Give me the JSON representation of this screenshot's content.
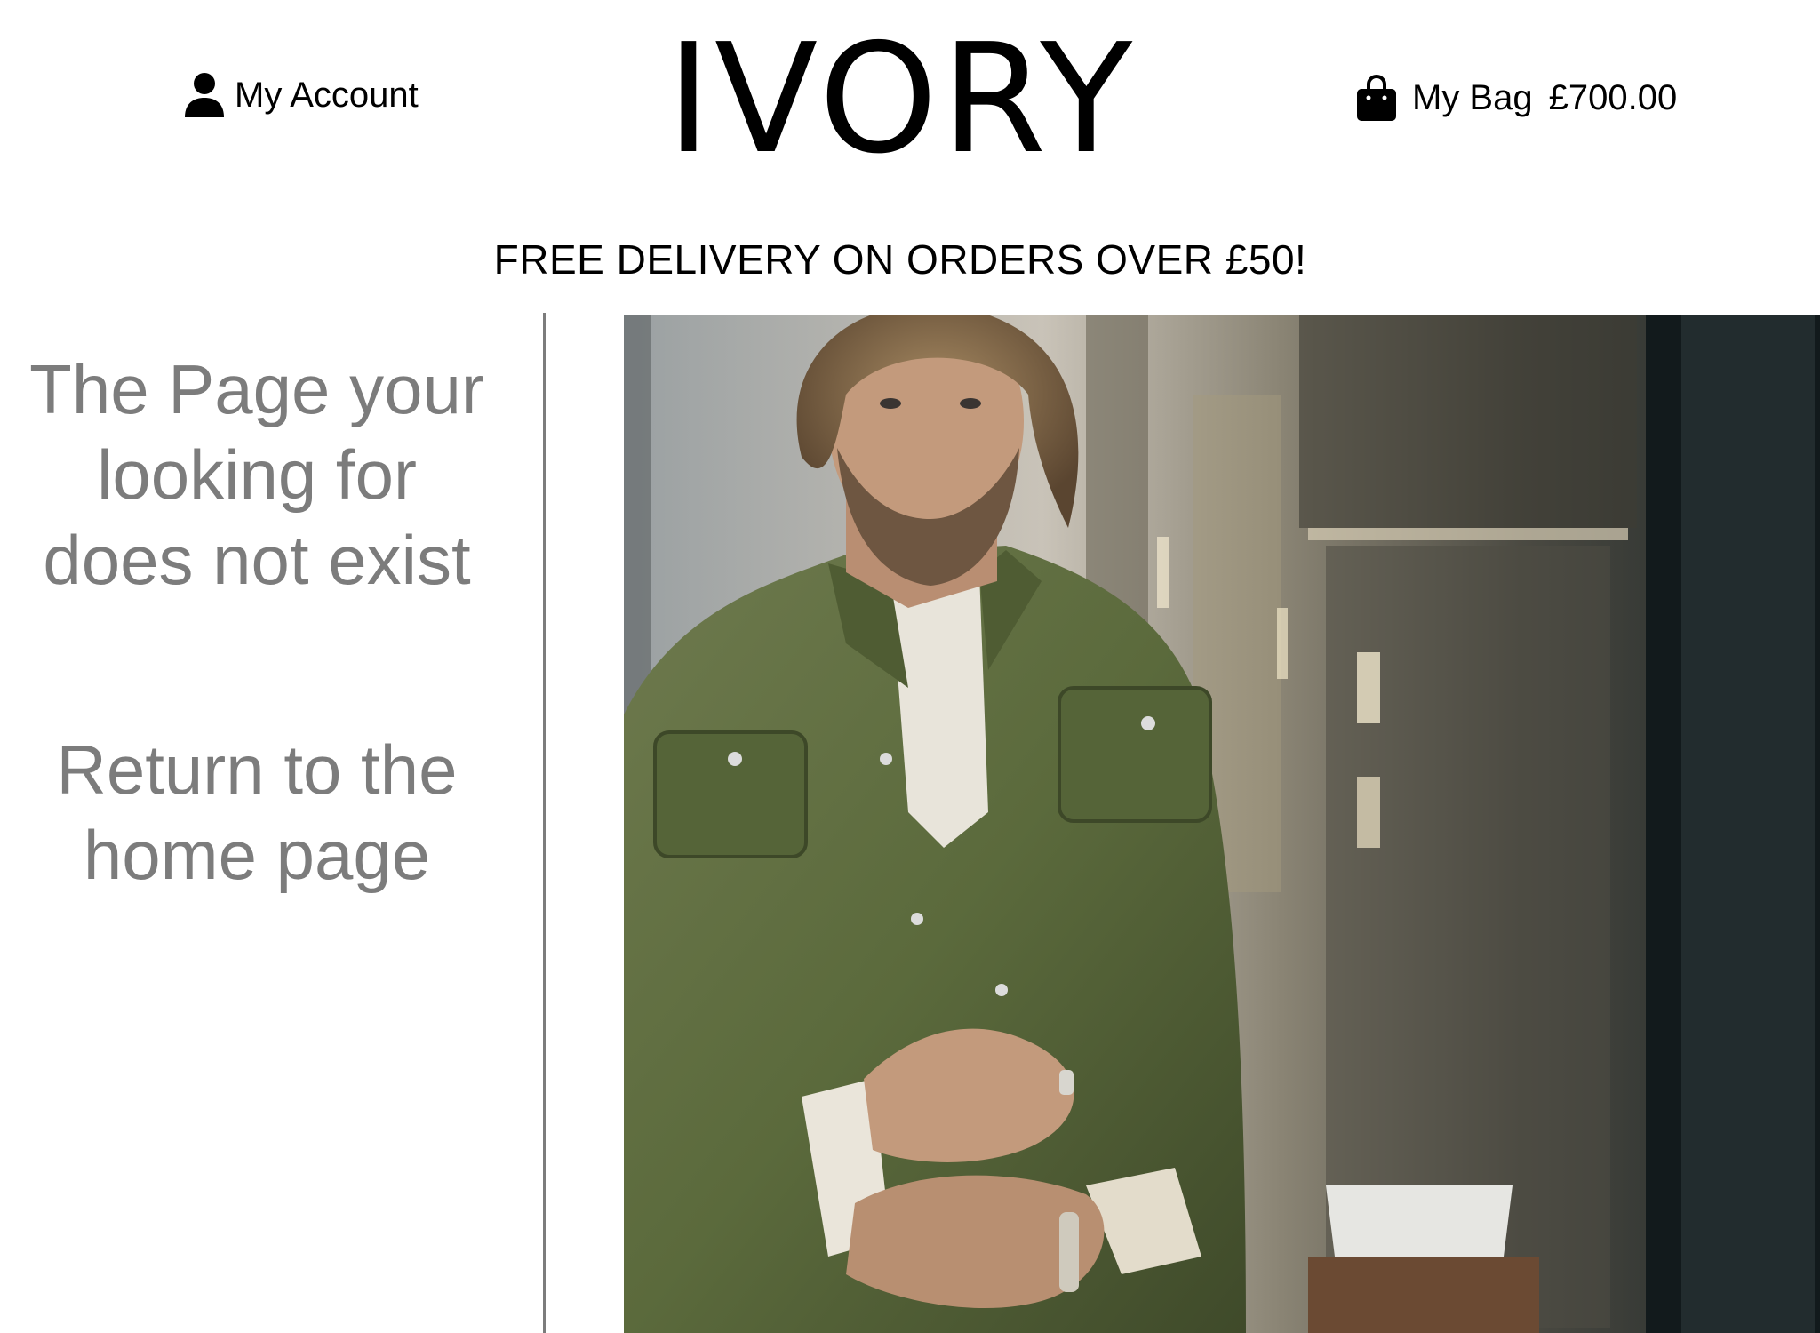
{
  "header": {
    "account_label": "My Account",
    "account_icon": "user-icon",
    "logo_text": "IVORY",
    "bag_label": "My Bag",
    "bag_total": "£700.00",
    "bag_icon": "shopping-bag-icon"
  },
  "promo": {
    "text": "FREE DELIVERY ON ORDERS OVER £50!"
  },
  "not_found": {
    "message_line1": "The Page your",
    "message_line2": "looking for",
    "message_line3": "does not exist",
    "home_link_line1": "Return to the",
    "home_link_line2": "home page"
  },
  "colors": {
    "text_primary": "#000000",
    "text_muted": "#7c7c7c",
    "background": "#ffffff",
    "divider": "#7c7c7c"
  }
}
